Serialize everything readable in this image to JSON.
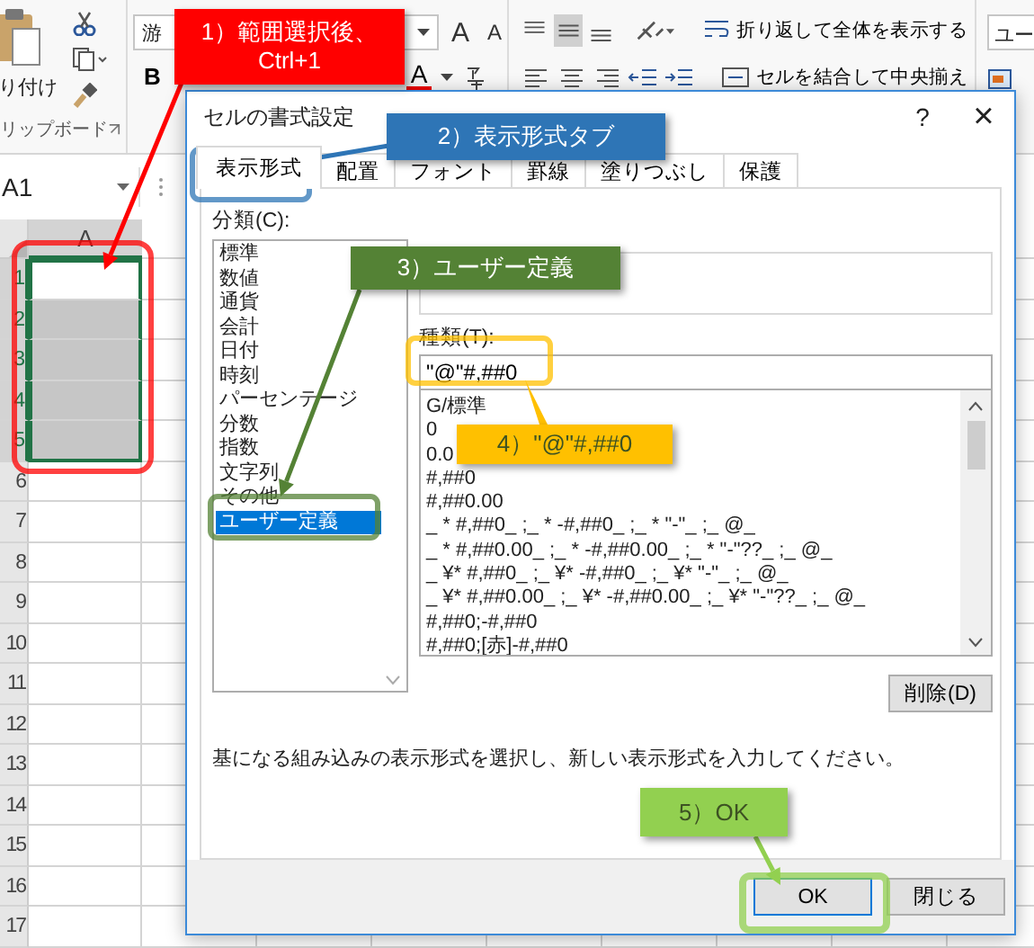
{
  "ribbon": {
    "paste_label": "り付け",
    "clipboard_group": "リップボード",
    "font_name": "游",
    "font_size_buttons": [
      "A",
      "A"
    ],
    "bold": "B",
    "font_color": "A",
    "wrap_text": "折り返して全体を表示する",
    "merge_center": "セルを結合して中央揃え",
    "number_format": "ユー"
  },
  "name_box": "A1",
  "sheet": {
    "column": "A",
    "rows": [
      {
        "label": "1",
        "selected": true,
        "active": true
      },
      {
        "label": "2",
        "selected": true,
        "active": false
      },
      {
        "label": "3",
        "selected": true,
        "active": false
      },
      {
        "label": "4",
        "selected": true,
        "active": false
      },
      {
        "label": "5",
        "selected": true,
        "active": false
      },
      {
        "label": "6",
        "selected": false,
        "active": false
      },
      {
        "label": "7",
        "selected": false,
        "active": false
      },
      {
        "label": "8",
        "selected": false,
        "active": false
      },
      {
        "label": "9",
        "selected": false,
        "active": false
      },
      {
        "label": "10",
        "selected": false,
        "active": false
      },
      {
        "label": "11",
        "selected": false,
        "active": false
      },
      {
        "label": "12",
        "selected": false,
        "active": false
      },
      {
        "label": "13",
        "selected": false,
        "active": false
      },
      {
        "label": "14",
        "selected": false,
        "active": false
      },
      {
        "label": "15",
        "selected": false,
        "active": false
      },
      {
        "label": "16",
        "selected": false,
        "active": false
      },
      {
        "label": "17",
        "selected": false,
        "active": false
      }
    ]
  },
  "dialog": {
    "title": "セルの書式設定",
    "help": "?",
    "close": "×",
    "tabs": [
      {
        "label": "表示形式",
        "selected": true
      },
      {
        "label": "配置",
        "selected": false
      },
      {
        "label": "フォント",
        "selected": false
      },
      {
        "label": "罫線",
        "selected": false
      },
      {
        "label": "塗りつぶし",
        "selected": false
      },
      {
        "label": "保護",
        "selected": false
      }
    ],
    "category_label": "分類(C):",
    "categories": [
      {
        "label": "標準",
        "selected": false
      },
      {
        "label": "数値",
        "selected": false
      },
      {
        "label": "通貨",
        "selected": false
      },
      {
        "label": "会計",
        "selected": false
      },
      {
        "label": "日付",
        "selected": false
      },
      {
        "label": "時刻",
        "selected": false
      },
      {
        "label": "パーセンテージ",
        "selected": false
      },
      {
        "label": "分数",
        "selected": false
      },
      {
        "label": "指数",
        "selected": false
      },
      {
        "label": "文字列",
        "selected": false
      },
      {
        "label": "その他",
        "selected": false
      },
      {
        "label": "ユーザー定義",
        "selected": true
      }
    ],
    "type_label": "種類(T):",
    "type_value": "\"@\"#,##0",
    "formats": [
      "G/標準",
      "0",
      "0.0",
      "#,##0",
      "#,##0.00",
      "_ * #,##0_ ;_ * -#,##0_ ;_ * \"-\"_ ;_ @_",
      "_ * #,##0.00_ ;_ * -#,##0.00_ ;_ * \"-\"??_ ;_ @_",
      "_ ¥* #,##0_ ;_ ¥* -#,##0_ ;_ ¥* \"-\"_ ;_ @_",
      "_ ¥* #,##0.00_ ;_ ¥* -#,##0.00_ ;_ ¥* \"-\"??_ ;_ @_",
      "#,##0;-#,##0",
      "#,##0;[赤]-#,##0"
    ],
    "delete_button": "削除(D)",
    "description": "基になる組み込みの表示形式を選択し、新しい表示形式を入力してください。",
    "ok_button": "OK",
    "close_button": "閉じる"
  },
  "callouts": [
    {
      "lines": [
        "1）範囲選択後、",
        "Ctrl+1"
      ],
      "color": "#ff0000"
    },
    {
      "lines": [
        "2）表示形式タブ"
      ],
      "color": "#2e75b6"
    },
    {
      "lines": [
        "3）ユーザー定義"
      ],
      "color": "#548235"
    },
    {
      "lines": [
        "4）\"@\"#,##0"
      ],
      "color": "#ffc000"
    },
    {
      "lines": [
        "5）OK"
      ],
      "color": "#92d050"
    }
  ]
}
